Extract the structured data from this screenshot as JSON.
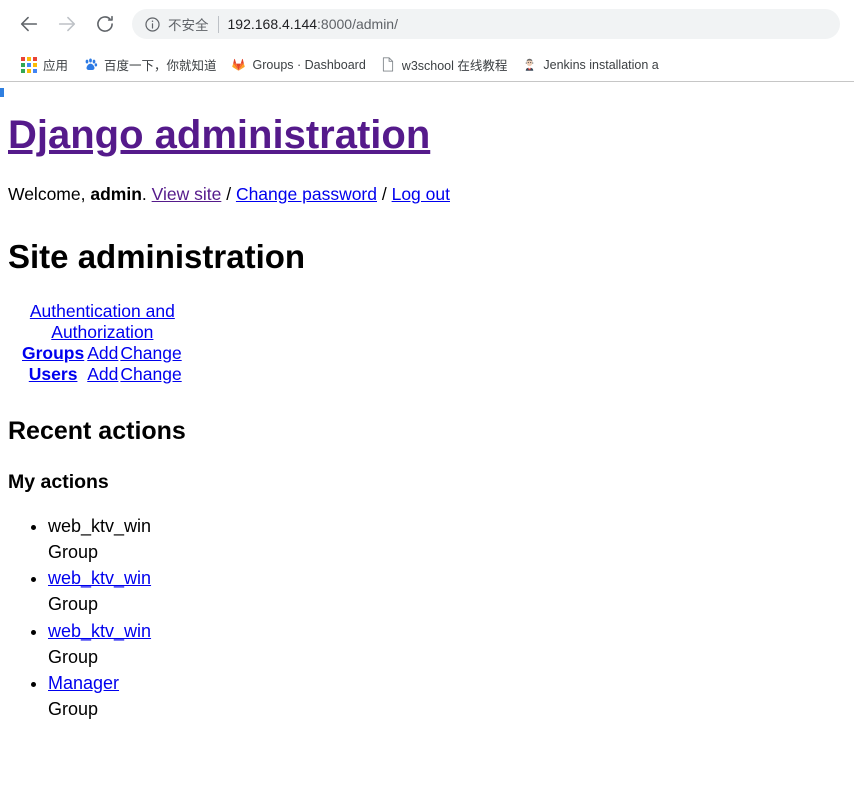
{
  "browser": {
    "nav": {
      "back_label": "Back",
      "forward_label": "Forward",
      "reload_label": "Reload"
    },
    "omnibox": {
      "info_icon": "info-circle-icon",
      "security_text": "不安全",
      "url_host": "192.168.4.144",
      "url_path": ":8000/admin/"
    },
    "bookmarks": [
      {
        "label": "应用",
        "icon": "apps-grid-icon"
      },
      {
        "label": "百度一下，你就知道",
        "icon": "baidu-paw-icon"
      },
      {
        "label": "Groups · Dashboard",
        "icon": "gitlab-fox-icon"
      },
      {
        "label": "w3school 在线教程",
        "icon": "document-page-icon"
      },
      {
        "label": "Jenkins installation a",
        "icon": "jenkins-butler-icon"
      }
    ]
  },
  "page": {
    "brand_title": "Django administration",
    "welcome": {
      "prefix": "Welcome, ",
      "username": "admin",
      "after_user": ". ",
      "view_site": "View site",
      "sep1": " / ",
      "change_password": "Change password",
      "sep2": " / ",
      "logout": "Log out"
    },
    "site_admin_title": "Site administration",
    "app_table": {
      "caption": "Authentication and Authorization",
      "rows": [
        {
          "model": "Groups",
          "add": "Add",
          "change": "Change"
        },
        {
          "model": "Users",
          "add": "Add",
          "change": "Change"
        }
      ]
    },
    "recent_actions_title": "Recent actions",
    "my_actions_title": "My actions",
    "actions": [
      {
        "name": "web_ktv_win",
        "is_link": false,
        "content_type": "Group"
      },
      {
        "name": "web_ktv_win",
        "is_link": true,
        "content_type": "Group"
      },
      {
        "name": "web_ktv_win",
        "is_link": true,
        "content_type": "Group"
      },
      {
        "name": "Manager",
        "is_link": true,
        "content_type": "Group"
      }
    ]
  },
  "colors": {
    "brand_purple": "#551a8b",
    "link_blue": "#0000ee",
    "chrome_gray": "#5f6368",
    "omnibox_bg": "#f1f3f4"
  }
}
